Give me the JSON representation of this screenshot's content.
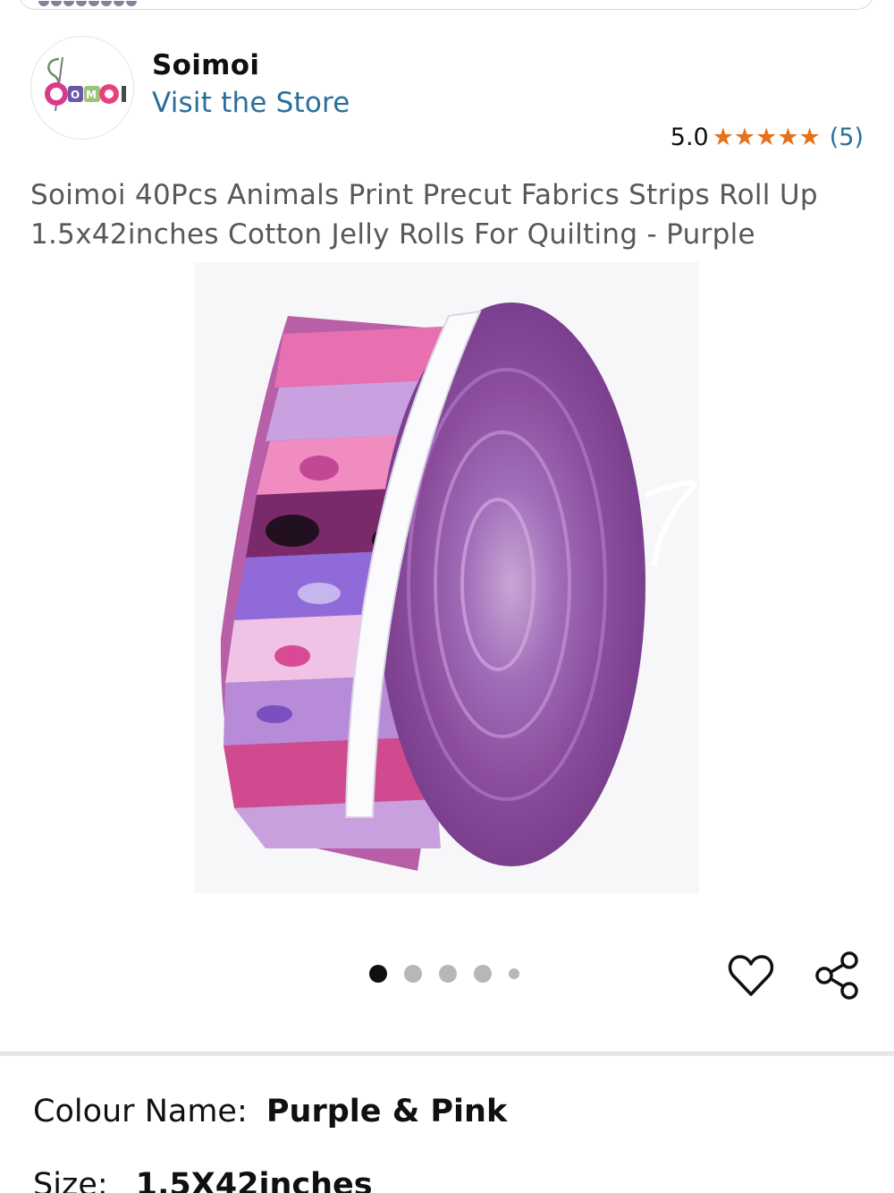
{
  "store": {
    "logo_text": "SOIMOI",
    "name": "Soimoi",
    "visit_label": "Visit the Store"
  },
  "rating": {
    "value": "5.0",
    "stars": "★★★★★",
    "count": "(5)"
  },
  "product": {
    "title": "Soimoi 40Pcs Animals Print Precut Fabrics Strips Roll Up 1.5x42inches Cotton Jelly Rolls For Quilting - Purple"
  },
  "carousel": {
    "total": 5,
    "active_index": 0
  },
  "icons": {
    "wishlist": "heart-icon",
    "share": "share-icon"
  },
  "variations": {
    "colour_label": "Colour Name:",
    "colour_value": "Purple & Pink",
    "size_label": "Size:",
    "size_value": "1.5X42inches"
  },
  "colors": {
    "link": "#2a6f9b",
    "star": "#e5711a",
    "title_text": "#565959"
  }
}
